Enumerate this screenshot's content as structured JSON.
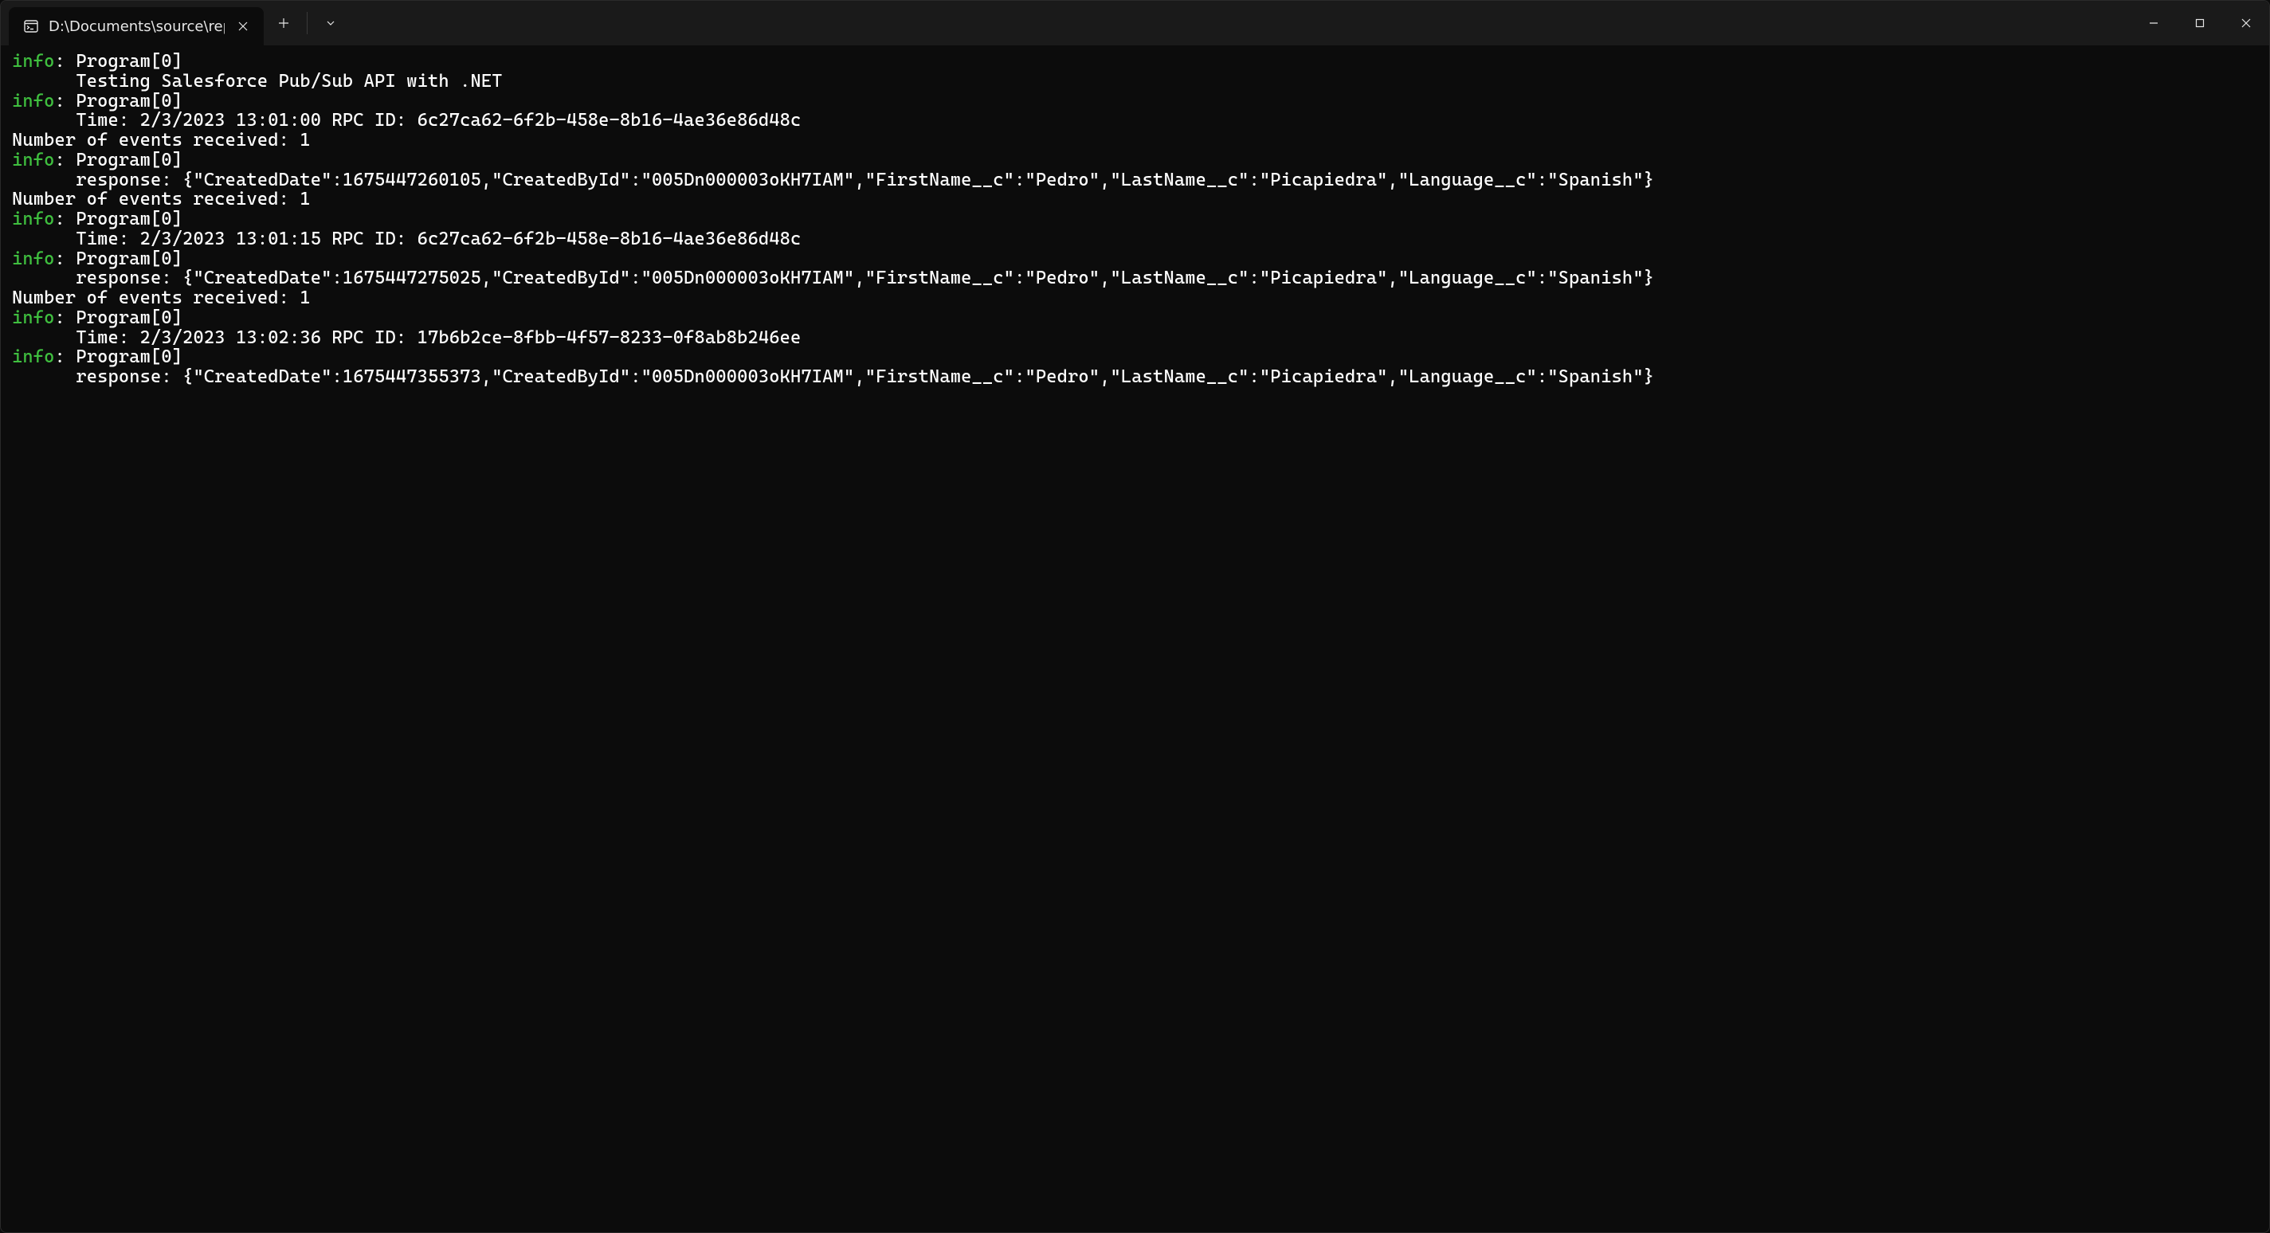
{
  "window": {
    "tab_title": "D:\\Documents\\source\\repos\\S",
    "minimize_tooltip": "Minimize",
    "maximize_tooltip": "Maximize",
    "close_tooltip": "Close",
    "new_tab_tooltip": "New Tab",
    "dropdown_tooltip": "New Tab Dropdown"
  },
  "log": {
    "info_label": "info",
    "program_label": "Program[0]",
    "indent": "      ",
    "events_received_label": "Number of events received:",
    "entries": [
      {
        "messages": [
          "Testing Salesforce Pub/Sub API with .NET"
        ]
      },
      {
        "messages": [
          "Time: 2/3/2023 13:01:00 RPC ID: 6c27ca62-6f2b-458e-8b16-4ae36e86d48c"
        ],
        "events_received": 1
      },
      {
        "messages": [
          "response: {\"CreatedDate\":1675447260105,\"CreatedById\":\"005Dn000003oKH7IAM\",\"FirstName__c\":\"Pedro\",\"LastName__c\":\"Picapiedra\",\"Language__c\":\"Spanish\"}"
        ],
        "events_received": 1
      },
      {
        "messages": [
          "Time: 2/3/2023 13:01:15 RPC ID: 6c27ca62-6f2b-458e-8b16-4ae36e86d48c"
        ]
      },
      {
        "messages": [
          "response: {\"CreatedDate\":1675447275025,\"CreatedById\":\"005Dn000003oKH7IAM\",\"FirstName__c\":\"Pedro\",\"LastName__c\":\"Picapiedra\",\"Language__c\":\"Spanish\"}"
        ],
        "events_received": 1
      },
      {
        "messages": [
          "Time: 2/3/2023 13:02:36 RPC ID: 17b6b2ce-8fbb-4f57-8233-0f8ab8b246ee"
        ]
      },
      {
        "messages": [
          "response: {\"CreatedDate\":1675447355373,\"CreatedById\":\"005Dn000003oKH7IAM\",\"FirstName__c\":\"Pedro\",\"LastName__c\":\"Picapiedra\",\"Language__c\":\"Spanish\"}"
        ]
      }
    ]
  }
}
